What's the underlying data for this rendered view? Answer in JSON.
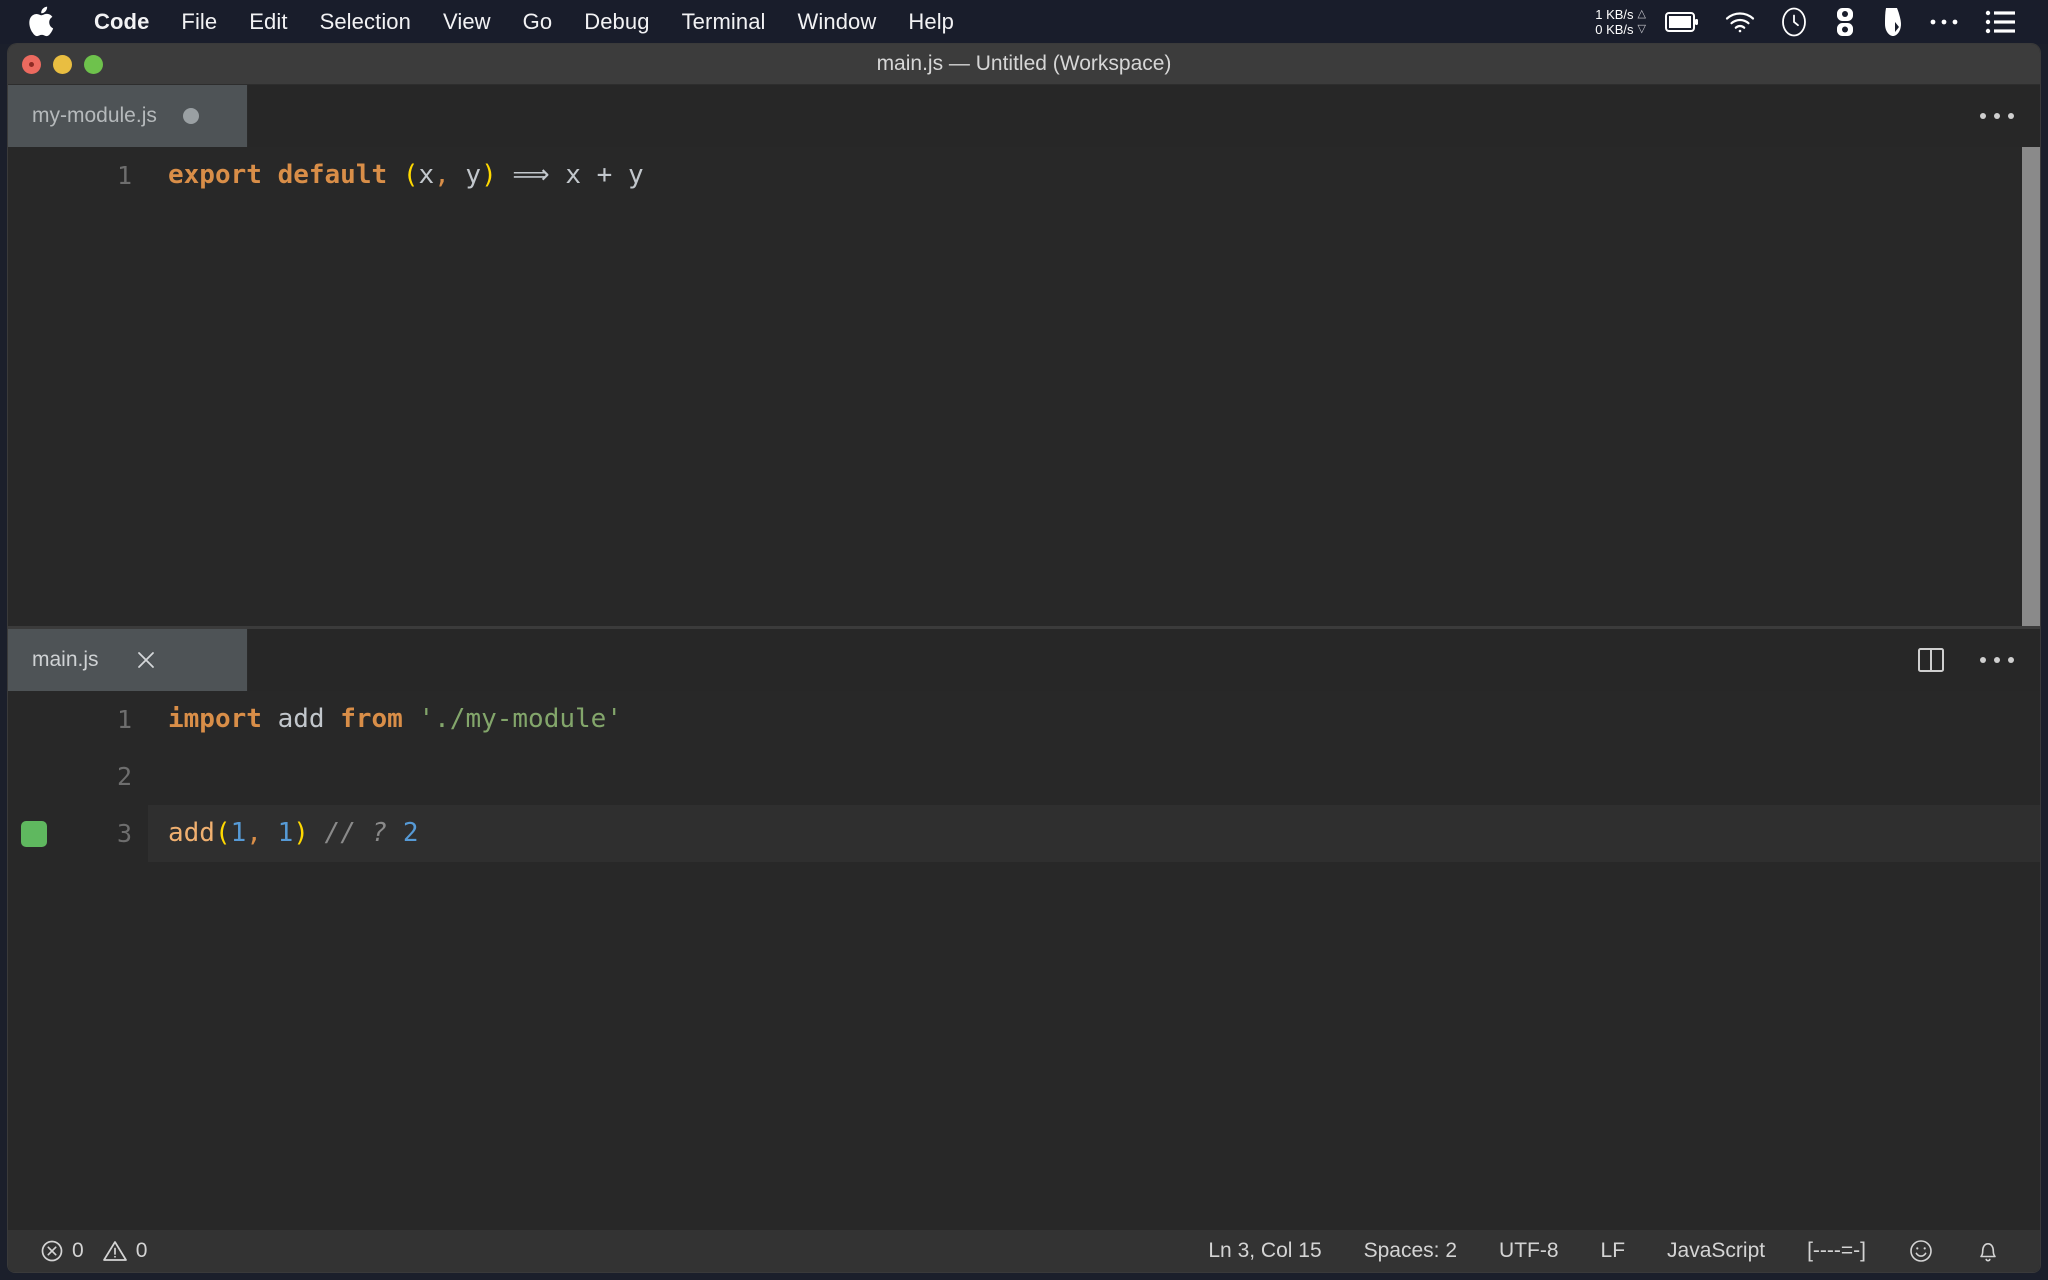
{
  "menubar": {
    "apple_icon": "apple-logo-icon",
    "items": [
      {
        "label": "Code",
        "bold": true
      },
      {
        "label": "File",
        "bold": false
      },
      {
        "label": "Edit",
        "bold": false
      },
      {
        "label": "Selection",
        "bold": false
      },
      {
        "label": "View",
        "bold": false
      },
      {
        "label": "Go",
        "bold": false
      },
      {
        "label": "Debug",
        "bold": false
      },
      {
        "label": "Terminal",
        "bold": false
      },
      {
        "label": "Window",
        "bold": false
      },
      {
        "label": "Help",
        "bold": false
      }
    ],
    "status": {
      "net_up": "1 KB/s",
      "net_down": "0 KB/s",
      "up_arrow": "△",
      "down_arrow": "▽",
      "icons": [
        "battery-icon",
        "wifi-icon",
        "time-machine-icon",
        "display-toggle-icon",
        "bartender-icon",
        "ellipsis-icon",
        "list-menu-icon"
      ]
    }
  },
  "window": {
    "title": "main.js — Untitled (Workspace)",
    "traffic_lights": [
      "close",
      "minimize",
      "zoom"
    ]
  },
  "editor_groups": [
    {
      "id": "group-top",
      "active": false,
      "tabs": [
        {
          "label": "my-module.js",
          "dirty": true,
          "active": true,
          "closable": false
        }
      ],
      "actions": [
        "ellipsis-icon"
      ],
      "lines": [
        {
          "number": "1",
          "current": false,
          "marker": null,
          "tokens": [
            {
              "text": "export default ",
              "type": "kw"
            },
            {
              "text": "(",
              "type": "paren"
            },
            {
              "text": "x",
              "type": "plain"
            },
            {
              "text": ",",
              "type": "comma"
            },
            {
              "text": " y",
              "type": "plain"
            },
            {
              "text": ")",
              "type": "paren"
            },
            {
              "text": " ⟹ ",
              "type": "arrow"
            },
            {
              "text": "x + y",
              "type": "plain"
            }
          ]
        }
      ],
      "scrollbar": {
        "visible": true,
        "thumb_top_pct": 0,
        "thumb_height_pct": 100
      }
    },
    {
      "id": "group-bottom",
      "active": true,
      "tabs": [
        {
          "label": "main.js",
          "dirty": false,
          "active": true,
          "closable": true,
          "close_icon": "close-icon"
        }
      ],
      "actions": [
        "split-editor-icon",
        "ellipsis-icon"
      ],
      "lines": [
        {
          "number": "1",
          "current": false,
          "marker": null,
          "tokens": [
            {
              "text": "import ",
              "type": "kw"
            },
            {
              "text": "add ",
              "type": "plain"
            },
            {
              "text": "from ",
              "type": "kw"
            },
            {
              "text": "'./my-module'",
              "type": "string"
            }
          ]
        },
        {
          "number": "2",
          "current": false,
          "marker": null,
          "tokens": []
        },
        {
          "number": "3",
          "current": true,
          "marker": {
            "type": "quokka-ok",
            "color": "#5fb85f"
          },
          "tokens": [
            {
              "text": "add",
              "type": "func"
            },
            {
              "text": "(",
              "type": "paren"
            },
            {
              "text": "1",
              "type": "num"
            },
            {
              "text": ",",
              "type": "comma"
            },
            {
              "text": " 1",
              "type": "num"
            },
            {
              "text": ")",
              "type": "paren"
            },
            {
              "text": " // ?",
              "type": "comment"
            },
            {
              "text": " 2",
              "type": "num"
            }
          ]
        }
      ],
      "scrollbar": {
        "visible": false
      }
    }
  ],
  "statusbar": {
    "errors": {
      "icon": "error-circle-icon",
      "count": "0"
    },
    "warnings": {
      "icon": "warning-triangle-icon",
      "count": "0"
    },
    "cursor_position": "Ln 3, Col 15",
    "indentation": "Spaces: 2",
    "encoding": "UTF-8",
    "eol": "LF",
    "language": "JavaScript",
    "extension_status": "[----=-]",
    "feedback_icon": "smiley-icon",
    "notifications_icon": "bell-icon"
  },
  "colors": {
    "menubar_bg": "#191d2b",
    "titlebar_bg": "#3c3c3c",
    "editor_bg": "#282828",
    "tab_active_bg": "#4e5356",
    "statusbar_bg": "#333333",
    "keyword": "#d98e48",
    "string": "#83a66b",
    "number": "#569ad6",
    "paren": "#ffd900",
    "comment": "#8a8a8a",
    "marker_green": "#5fb85f"
  }
}
